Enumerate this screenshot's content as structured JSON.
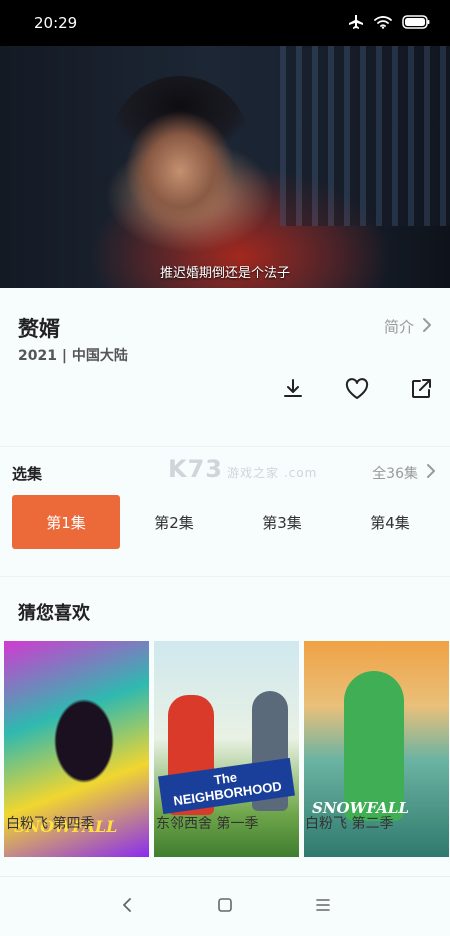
{
  "status_bar": {
    "time": "20:29"
  },
  "video": {
    "subtitle": "推迟婚期倒还是个法子"
  },
  "show": {
    "title": "赘婿",
    "intro_label": "简介",
    "meta": "2021 | 中国大陆"
  },
  "episodes": {
    "header": "选集",
    "total": "全36集",
    "items": [
      "第1集",
      "第2集",
      "第3集",
      "第4集"
    ],
    "selected": 0,
    "watermark_logo": "K73",
    "watermark_text": "游戏之家 .com"
  },
  "recommendations": {
    "header": "猜您喜欢",
    "items": [
      {
        "caption": "白粉飞 第四季",
        "poster_text": "SNOWFALL"
      },
      {
        "caption": "东邻西舍 第一季",
        "poster_text": "The NEIGHBORHOOD"
      },
      {
        "caption": "白粉飞 第二季",
        "poster_text": "SNOWFALL"
      }
    ]
  },
  "colors": {
    "accent": "#ec6a3a",
    "muted": "#9a9a9a",
    "background": "#f7fcfd"
  },
  "icons": [
    "airplane-icon",
    "wifi-icon",
    "battery-icon",
    "chevron-right-icon",
    "download-icon",
    "heart-icon",
    "share-icon",
    "back-icon",
    "home-icon",
    "menu-icon"
  ]
}
